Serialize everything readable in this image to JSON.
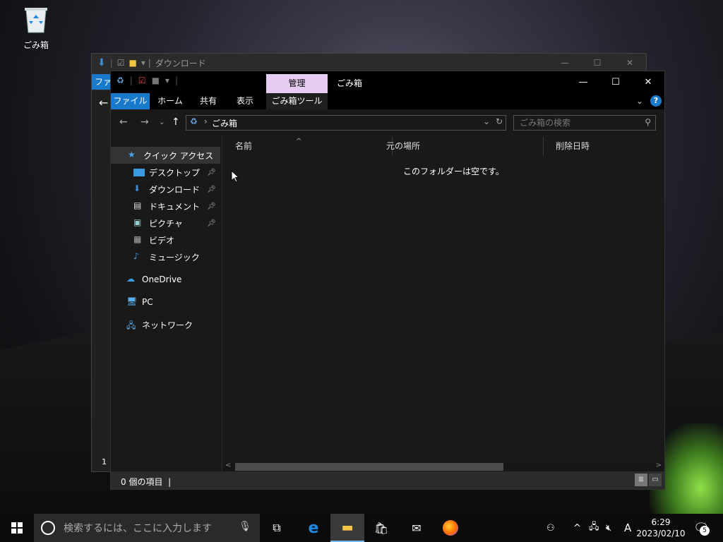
{
  "desktop": {
    "recycle_bin_label": "ごみ箱"
  },
  "back_window": {
    "title": "ダウンロード",
    "file_tab": "ファ",
    "status_fragment": "1"
  },
  "window": {
    "title": "ごみ箱",
    "context_tab": "管理",
    "ribbon_tabs": [
      "ファイル",
      "ホーム",
      "共有",
      "表示",
      "ごみ箱ツール"
    ],
    "controls": {
      "minimize": "—",
      "maximize": "☐",
      "close": "✕"
    }
  },
  "address": {
    "path": "ごみ箱",
    "search_placeholder": "ごみ箱の検索"
  },
  "sidebar": {
    "quick_access": "クイック アクセス",
    "items": [
      "デスクトップ",
      "ダウンロード",
      "ドキュメント",
      "ピクチャ",
      "ビデオ",
      "ミュージック"
    ],
    "onedrive": "OneDrive",
    "pc": "PC",
    "network": "ネットワーク"
  },
  "content": {
    "columns": [
      "名前",
      "元の場所",
      "削除日時"
    ],
    "empty_message": "このフォルダーは空です。"
  },
  "status": {
    "item_count": "0 個の項目"
  },
  "taskbar": {
    "search_placeholder": "検索するには、ここに入力します",
    "ime": "A",
    "time": "6:29",
    "date": "2023/02/10",
    "notification_count": "5"
  },
  "colors": {
    "accent": "#1979ca",
    "manage_tab": "#e6cbf3"
  }
}
